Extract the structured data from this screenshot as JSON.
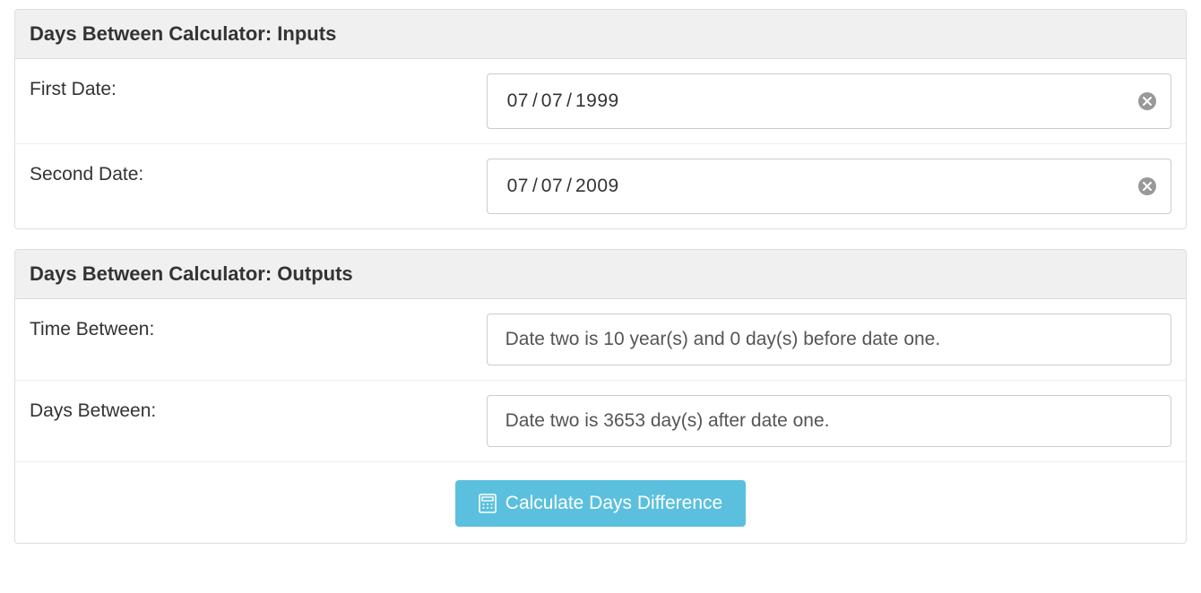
{
  "inputs_panel": {
    "title": "Days Between Calculator: Inputs",
    "first_date": {
      "label": "First Date:",
      "mm": "07",
      "dd": "07",
      "yyyy": "1999"
    },
    "second_date": {
      "label": "Second Date:",
      "mm": "07",
      "dd": "07",
      "yyyy": "2009"
    }
  },
  "outputs_panel": {
    "title": "Days Between Calculator: Outputs",
    "time_between": {
      "label": "Time Between:",
      "value": "Date two is 10 year(s) and 0 day(s) before date one."
    },
    "days_between": {
      "label": "Days Between:",
      "value": "Date two is 3653 day(s) after date one."
    },
    "button_label": "Calculate Days Difference"
  }
}
